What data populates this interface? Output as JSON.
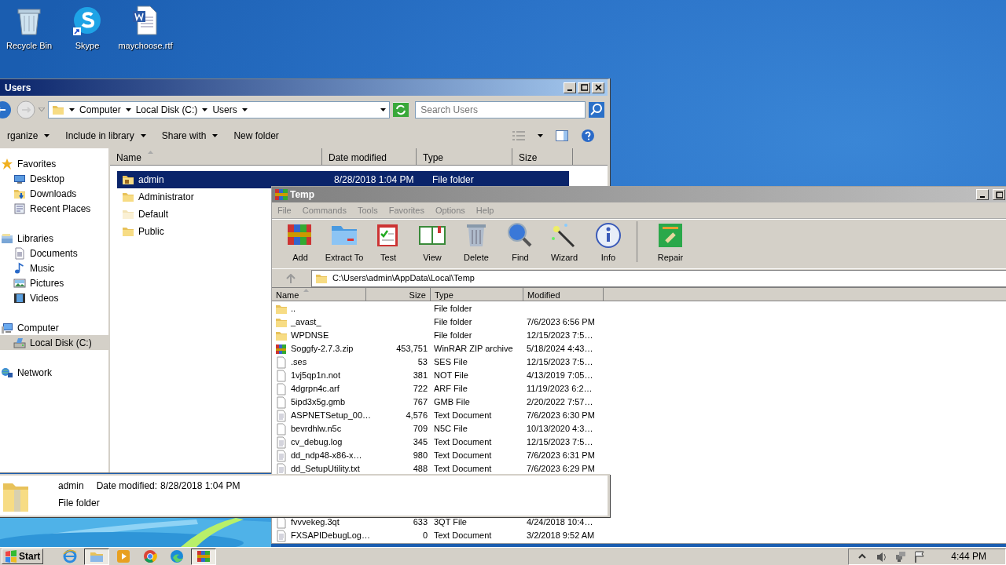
{
  "desktop_icons": [
    {
      "label": "Recycle Bin",
      "kind": "recycle"
    },
    {
      "label": "Skype",
      "kind": "skype"
    },
    {
      "label": "maychoose.rtf",
      "kind": "word"
    }
  ],
  "explorer": {
    "title": "Users",
    "breadcrumb": [
      "Computer",
      "Local Disk (C:)",
      "Users"
    ],
    "search": {
      "placeholder": "Search Users"
    },
    "toolbar": [
      {
        "label": "rganize",
        "dropdown": true
      },
      {
        "label": "Include in library",
        "dropdown": true
      },
      {
        "label": "Share with",
        "dropdown": true
      },
      {
        "label": "New folder",
        "dropdown": false
      }
    ],
    "nav": [
      {
        "label": "Favorites",
        "kind": "star",
        "selected": false,
        "children": [
          {
            "label": "Desktop",
            "kind": "desktop",
            "selected": false
          },
          {
            "label": "Downloads",
            "kind": "download",
            "selected": false
          },
          {
            "label": "Recent Places",
            "kind": "recent",
            "selected": false
          }
        ]
      },
      {
        "label": "Libraries",
        "kind": "library",
        "selected": false,
        "children": [
          {
            "label": "Documents",
            "kind": "document",
            "selected": false
          },
          {
            "label": "Music",
            "kind": "music",
            "selected": false
          },
          {
            "label": "Pictures",
            "kind": "pictures",
            "selected": false
          },
          {
            "label": "Videos",
            "kind": "videos",
            "selected": false
          }
        ]
      },
      {
        "label": "Computer",
        "kind": "computer",
        "selected": false,
        "children": [
          {
            "label": "Local Disk (C:)",
            "kind": "disk",
            "selected": true
          }
        ]
      },
      {
        "label": "Network",
        "kind": "network",
        "selected": false
      }
    ],
    "columns": [
      "Name",
      "Date modified",
      "Type",
      "Size"
    ],
    "files": [
      {
        "name": "admin",
        "date": "8/28/2018 1:04 PM",
        "type": "File folder",
        "kind": "user-folder",
        "selected": true
      },
      {
        "name": "Administrator",
        "kind": "folder",
        "selected": false
      },
      {
        "name": "Default",
        "kind": "faded-folder",
        "selected": false
      },
      {
        "name": "Public",
        "kind": "folder",
        "selected": false
      }
    ],
    "details": {
      "name": "admin",
      "date_label": "Date modified:",
      "date": "8/28/2018 1:04 PM",
      "type": "File folder"
    }
  },
  "winrar": {
    "title": "Temp",
    "menu": [
      "File",
      "Commands",
      "Tools",
      "Favorites",
      "Options",
      "Help"
    ],
    "tools": [
      {
        "label": "Add",
        "kind": "add"
      },
      {
        "label": "Extract To",
        "kind": "extract"
      },
      {
        "label": "Test",
        "kind": "test"
      },
      {
        "label": "View",
        "kind": "view"
      },
      {
        "label": "Delete",
        "kind": "delete"
      },
      {
        "label": "Find",
        "kind": "find"
      },
      {
        "label": "Wizard",
        "kind": "wizard"
      },
      {
        "label": "Info",
        "kind": "info"
      },
      {
        "label": "Repair",
        "kind": "repair"
      }
    ],
    "address": "C:\\Users\\admin\\AppData\\Local\\Temp",
    "columns": [
      "Name",
      "Size",
      "Type",
      "Modified"
    ],
    "rows_top": [
      {
        "name": "..",
        "type": "File folder",
        "kind": "folder"
      },
      {
        "name": "_avast_",
        "type": "File folder",
        "modified": "7/6/2023 6:56 PM",
        "kind": "folder"
      },
      {
        "name": "WPDNSE",
        "type": "File folder",
        "modified": "12/15/2023 7:5…",
        "kind": "folder"
      },
      {
        "name": "Soggfy-2.7.3.zip",
        "size": "453,751",
        "type": "WinRAR ZIP archive",
        "modified": "5/18/2024 4:43…",
        "kind": "archive"
      },
      {
        "name": ".ses",
        "size": "53",
        "type": "SES File",
        "modified": "12/15/2023 7:5…",
        "kind": "file"
      },
      {
        "name": "1vj5qp1n.not",
        "size": "381",
        "type": "NOT File",
        "modified": "4/13/2019 7:05…",
        "kind": "file"
      },
      {
        "name": "4dgrpn4c.arf",
        "size": "722",
        "type": "ARF File",
        "modified": "11/19/2023 6:2…",
        "kind": "file"
      },
      {
        "name": "5ipd3x5g.gmb",
        "size": "767",
        "type": "GMB File",
        "modified": "2/20/2022 7:57…",
        "kind": "file"
      },
      {
        "name": "ASPNETSetup_00…",
        "size": "4,576",
        "type": "Text Document",
        "modified": "7/6/2023 6:30 PM",
        "kind": "text"
      },
      {
        "name": "bevrdhlw.n5c",
        "size": "709",
        "type": "N5C File",
        "modified": "10/13/2020 4:3…",
        "kind": "file"
      },
      {
        "name": "cv_debug.log",
        "size": "345",
        "type": "Text Document",
        "modified": "12/15/2023 7:5…",
        "kind": "text"
      },
      {
        "name": "dd_ndp48-x86-x…",
        "size": "980",
        "type": "Text Document",
        "modified": "7/6/2023 6:31 PM",
        "kind": "text"
      },
      {
        "name": "dd_SetupUtility.txt",
        "size": "488",
        "type": "Text Document",
        "modified": "7/6/2023 6:29 PM",
        "kind": "text"
      }
    ],
    "rows_bottom": [
      {
        "name": "fvvvekeg.3qt",
        "size": "633",
        "type": "3QT File",
        "modified": "4/24/2018 10:4…",
        "kind": "file"
      },
      {
        "name": "FXSAPIDebugLog…",
        "size": "0",
        "type": "Text Document",
        "modified": "3/2/2018 9:52 AM",
        "kind": "text"
      }
    ]
  },
  "taskbar": {
    "start": "Start",
    "apps": [
      {
        "kind": "ie",
        "selected": false
      },
      {
        "kind": "explorer",
        "selected": true
      },
      {
        "kind": "media",
        "selected": false
      },
      {
        "kind": "chrome",
        "selected": false
      },
      {
        "kind": "edge",
        "selected": false
      },
      {
        "kind": "winrar",
        "selected": true
      }
    ],
    "time": "4:44 PM"
  }
}
